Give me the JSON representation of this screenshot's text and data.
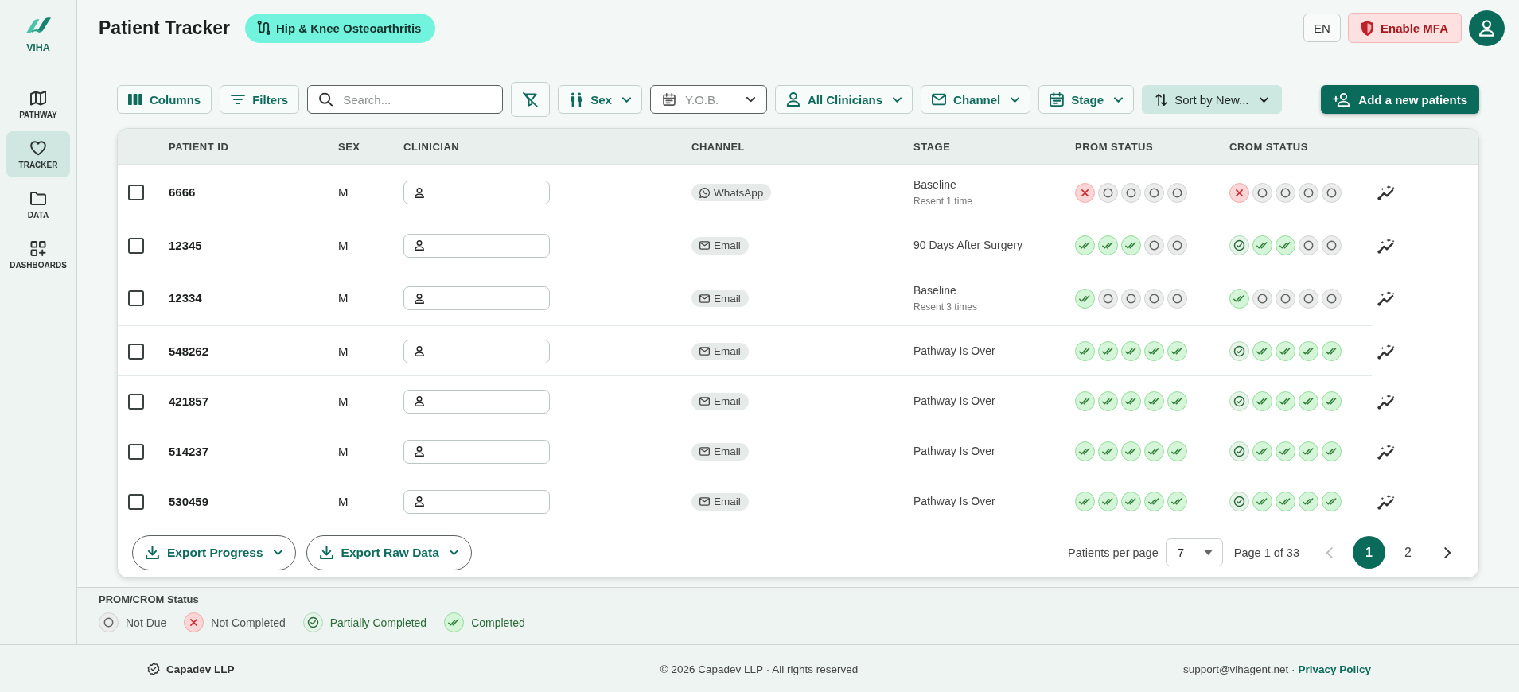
{
  "sidebar": {
    "brand": "ViHA",
    "items": [
      {
        "label": "PATHWAY",
        "selected": false
      },
      {
        "label": "TRACKER",
        "selected": true
      },
      {
        "label": "DATA",
        "selected": false
      },
      {
        "label": "DASHBOARDS",
        "selected": false
      }
    ]
  },
  "header": {
    "title": "Patient Tracker",
    "pathway_chip": "Hip & Knee Osteoarthritis",
    "language_button": "EN",
    "mfa_button": "Enable MFA"
  },
  "toolbar": {
    "items": [
      {
        "kind": "button",
        "label": "Columns"
      },
      {
        "kind": "button",
        "label": "Filters"
      },
      {
        "kind": "search",
        "placeholder": "Search..."
      },
      {
        "kind": "icon_button"
      },
      {
        "kind": "dropdown",
        "label": "Sex"
      },
      {
        "kind": "select",
        "placeholder": "Y.O.B."
      },
      {
        "kind": "dropdown",
        "label": "All Clinicians"
      },
      {
        "kind": "dropdown",
        "label": "Channel"
      },
      {
        "kind": "dropdown",
        "label": "Stage"
      },
      {
        "kind": "sort",
        "label": "Sort by New..."
      }
    ],
    "add_button": "Add a new patients"
  },
  "table": {
    "columns": [
      "PATIENT ID",
      "SEX",
      "CLINICIAN",
      "CHANNEL",
      "STAGE",
      "PROM STATUS",
      "CROM STATUS"
    ],
    "rows": [
      {
        "selected": false,
        "patient_id": "6666",
        "sex": "M",
        "channel": {
          "kind": "whatsapp",
          "label": "WhatsApp"
        },
        "stage": "Baseline",
        "stage_note": "Resent 1 time",
        "prom_status": [
          {
            "kind": "not_completed"
          },
          {
            "kind": "not_due"
          },
          {
            "kind": "not_due"
          },
          {
            "kind": "not_due"
          },
          {
            "kind": "not_due"
          }
        ],
        "crom_status": [
          {
            "kind": "not_completed"
          },
          {
            "kind": "not_due"
          },
          {
            "kind": "not_due"
          },
          {
            "kind": "not_due"
          },
          {
            "kind": "not_due"
          }
        ]
      },
      {
        "selected": false,
        "patient_id": "12345",
        "sex": "M",
        "channel": {
          "kind": "email",
          "label": "Email"
        },
        "stage": "90 Days After Surgery",
        "prom_status": [
          {
            "kind": "completed"
          },
          {
            "kind": "completed"
          },
          {
            "kind": "completed"
          },
          {
            "kind": "not_due"
          },
          {
            "kind": "not_due"
          }
        ],
        "crom_status": [
          {
            "kind": "partial"
          },
          {
            "kind": "completed"
          },
          {
            "kind": "completed"
          },
          {
            "kind": "not_due"
          },
          {
            "kind": "not_due"
          }
        ]
      },
      {
        "selected": false,
        "patient_id": "12334",
        "sex": "M",
        "channel": {
          "kind": "email",
          "label": "Email"
        },
        "stage": "Baseline",
        "stage_note": "Resent 3 times",
        "prom_status": [
          {
            "kind": "completed"
          },
          {
            "kind": "not_due"
          },
          {
            "kind": "not_due"
          },
          {
            "kind": "not_due"
          },
          {
            "kind": "not_due"
          }
        ],
        "crom_status": [
          {
            "kind": "completed"
          },
          {
            "kind": "not_due"
          },
          {
            "kind": "not_due"
          },
          {
            "kind": "not_due"
          },
          {
            "kind": "not_due"
          }
        ]
      },
      {
        "selected": false,
        "patient_id": "548262",
        "sex": "M",
        "channel": {
          "kind": "email",
          "label": "Email"
        },
        "stage": "Pathway Is Over",
        "prom_status": [
          {
            "kind": "completed"
          },
          {
            "kind": "completed"
          },
          {
            "kind": "completed"
          },
          {
            "kind": "completed"
          },
          {
            "kind": "completed"
          }
        ],
        "crom_status": [
          {
            "kind": "partial"
          },
          {
            "kind": "completed"
          },
          {
            "kind": "completed"
          },
          {
            "kind": "completed"
          },
          {
            "kind": "completed"
          }
        ]
      },
      {
        "selected": false,
        "patient_id": "421857",
        "sex": "M",
        "channel": {
          "kind": "email",
          "label": "Email"
        },
        "stage": "Pathway Is Over",
        "prom_status": [
          {
            "kind": "completed"
          },
          {
            "kind": "completed"
          },
          {
            "kind": "completed"
          },
          {
            "kind": "completed"
          },
          {
            "kind": "completed"
          }
        ],
        "crom_status": [
          {
            "kind": "partial"
          },
          {
            "kind": "completed"
          },
          {
            "kind": "completed"
          },
          {
            "kind": "completed"
          },
          {
            "kind": "completed"
          }
        ]
      },
      {
        "selected": false,
        "patient_id": "514237",
        "sex": "M",
        "channel": {
          "kind": "email",
          "label": "Email"
        },
        "stage": "Pathway Is Over",
        "prom_status": [
          {
            "kind": "completed"
          },
          {
            "kind": "completed"
          },
          {
            "kind": "completed"
          },
          {
            "kind": "completed"
          },
          {
            "kind": "completed"
          }
        ],
        "crom_status": [
          {
            "kind": "partial"
          },
          {
            "kind": "completed"
          },
          {
            "kind": "completed"
          },
          {
            "kind": "completed"
          },
          {
            "kind": "completed"
          }
        ]
      },
      {
        "selected": false,
        "patient_id": "530459",
        "sex": "M",
        "channel": {
          "kind": "email",
          "label": "Email"
        },
        "stage": "Pathway Is Over",
        "prom_status": [
          {
            "kind": "completed"
          },
          {
            "kind": "completed"
          },
          {
            "kind": "completed"
          },
          {
            "kind": "completed"
          },
          {
            "kind": "completed"
          }
        ],
        "crom_status": [
          {
            "kind": "partial"
          },
          {
            "kind": "completed"
          },
          {
            "kind": "completed"
          },
          {
            "kind": "completed"
          },
          {
            "kind": "completed"
          }
        ]
      }
    ],
    "export_buttons": [
      "Export Progress",
      "Export Raw Data"
    ],
    "pagination": {
      "per_page_label": "Patients per page",
      "per_page": "7",
      "page_info": "Page 1 of 33",
      "previous": {
        "disabled": true
      },
      "pages": [
        {
          "label": "1",
          "selected": true
        },
        {
          "label": "2",
          "selected": false
        }
      ],
      "next": {
        "disabled": false
      }
    }
  },
  "legend": {
    "title": "PROM/CROM Status",
    "items": [
      {
        "kind": "not_due",
        "label": "Not Due"
      },
      {
        "kind": "not_completed",
        "label": "Not Completed"
      },
      {
        "kind": "partial",
        "label": "Partially Completed"
      },
      {
        "kind": "completed",
        "label": "Completed"
      }
    ]
  },
  "footer": {
    "company": "Capadev LLP",
    "copyright": "© 2026 Capadev LLP · All rights reserved",
    "contact": "support@vihagent.net ·",
    "privacy_link": "Privacy Policy"
  }
}
